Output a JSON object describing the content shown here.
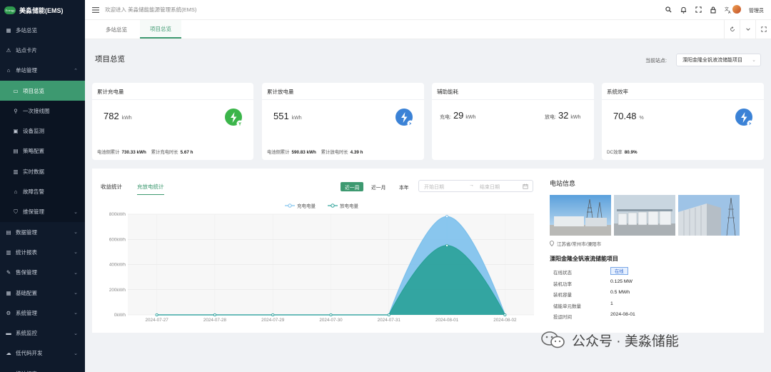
{
  "app": {
    "name": "美淼储能(EMS)",
    "logo_text": "Energy"
  },
  "topbar": {
    "welcome": "欢迎进入 美淼储能能源管理系统(EMS)",
    "user": "管理员"
  },
  "sidebar": [
    {
      "label": "多站总览",
      "icon": "dashboard-icon"
    },
    {
      "label": "站点卡片",
      "icon": "card-icon"
    },
    {
      "label": "单站管理",
      "icon": "home-icon",
      "expand": "up"
    },
    {
      "label": "项目总览",
      "icon": "overview-icon",
      "sub": true,
      "active": true
    },
    {
      "label": "一次接线图",
      "icon": "diagram-icon",
      "sub": true
    },
    {
      "label": "设备监测",
      "icon": "monitor-icon",
      "sub": true
    },
    {
      "label": "策略配置",
      "icon": "strategy-icon",
      "sub": true
    },
    {
      "label": "实时数据",
      "icon": "realtime-icon",
      "sub": true
    },
    {
      "label": "故障告警",
      "icon": "alarm-icon",
      "sub": true
    },
    {
      "label": "维保管理",
      "icon": "shield-icon",
      "sub": true,
      "expand": "down"
    },
    {
      "label": "数据管理",
      "icon": "data-icon",
      "expand": "down"
    },
    {
      "label": "统计报表",
      "icon": "report-icon",
      "expand": "down"
    },
    {
      "label": "售保管理",
      "icon": "service-icon",
      "expand": "down"
    },
    {
      "label": "基础配置",
      "icon": "config-icon",
      "expand": "down"
    },
    {
      "label": "系统管理",
      "icon": "gear-icon",
      "expand": "down"
    },
    {
      "label": "系统监控",
      "icon": "monitor-screen-icon",
      "expand": "down"
    },
    {
      "label": "低代码开发",
      "icon": "cloud-icon",
      "expand": "down"
    },
    {
      "label": "统计报表",
      "icon": "report-icon"
    }
  ],
  "tabs": [
    "多站总览",
    "项目总览"
  ],
  "page": {
    "title": "项目总览",
    "station_label": "当前站点:",
    "station_value": "溧阳金隆全钒液流储能项目"
  },
  "cards": {
    "charge": {
      "title": "累计充电量",
      "value": "782",
      "unit": "kWh",
      "foot1_label": "电池侧累计",
      "foot1_value": "730.33 kWh",
      "foot2_label": "累计充电时长",
      "foot2_value": "5.67 h"
    },
    "discharge": {
      "title": "累计放电量",
      "value": "551",
      "unit": "kWh",
      "foot1_label": "电池侧累计",
      "foot1_value": "590.83 kWh",
      "foot2_label": "累计放电时长",
      "foot2_value": "4.39 h"
    },
    "aux": {
      "title": "辅助能耗",
      "charge_label": "充电:",
      "charge_value": "29",
      "charge_unit": "kWh",
      "discharge_label": "放电:",
      "discharge_value": "32",
      "discharge_unit": "kWh"
    },
    "efficiency": {
      "title": "系统效率",
      "value": "70.48",
      "unit": "%",
      "foot_label": "DC效率",
      "foot_value": "80.9%"
    }
  },
  "chart_tabs": {
    "income": "收益统计",
    "energy": "充放电统计"
  },
  "range_buttons": {
    "week": "近一周",
    "month": "近一月",
    "year": "本年"
  },
  "datepicker": {
    "start_placeholder": "开始日期",
    "end_placeholder": "结束日期"
  },
  "chart_data": {
    "type": "area",
    "x": [
      "2024-07-27",
      "2024-07-28",
      "2024-07-29",
      "2024-07-30",
      "2024-07-31",
      "2024-08-01",
      "2024-08-02"
    ],
    "series": [
      {
        "name": "充电电量",
        "color": "#7cc0ec",
        "values": [
          0,
          0,
          0,
          0,
          0,
          782,
          0
        ]
      },
      {
        "name": "放电电量",
        "color": "#2aa198",
        "values": [
          0,
          0,
          0,
          0,
          0,
          551,
          0
        ]
      }
    ],
    "yticks": [
      "0kWh",
      "200kWh",
      "400kWh",
      "600kWh",
      "800kWh"
    ],
    "ylim": [
      0,
      800
    ],
    "smooth": true,
    "legend_position": "top-center",
    "grid": true
  },
  "station_info": {
    "title": "电站信息",
    "location": "江苏省/常州市/溧阳市",
    "project_name": "溧阳金隆全钒液流储能项目",
    "rows": [
      {
        "label": "在线状态",
        "value": "在线",
        "badge": true
      },
      {
        "label": "装机功率",
        "value": "0.125 MW"
      },
      {
        "label": "装机容量",
        "value": "0.5 MWh"
      },
      {
        "label": "储能单元数量",
        "value": "1"
      },
      {
        "label": "投运时间",
        "value": "2024-08-01"
      }
    ]
  },
  "watermark": "公众号 · 美淼储能",
  "colors": {
    "accent": "#3d9970",
    "sidebar": "#0f1a2b",
    "charge": "#7cc0ec",
    "discharge": "#2aa198",
    "icon_blue": "#3b82d6",
    "icon_green": "#3bb54a"
  }
}
